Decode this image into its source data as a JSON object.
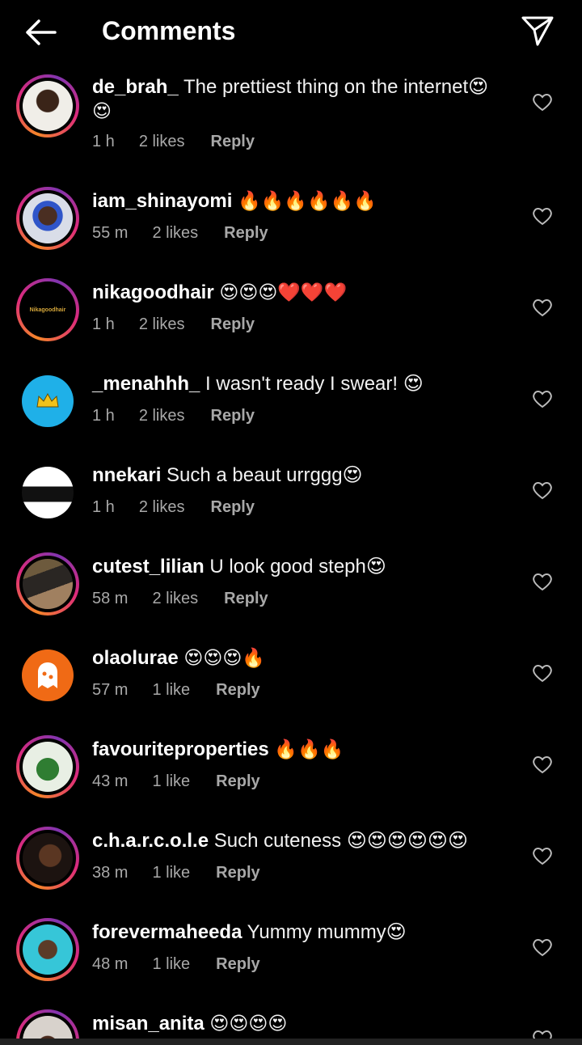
{
  "header": {
    "title": "Comments",
    "back_icon": "arrow-left-icon",
    "share_icon": "paper-plane-icon"
  },
  "colors": {
    "background": "#000000",
    "meta_text": "#a8a8a8",
    "ring_start": "#f58529",
    "ring_end": "#dd2a7b"
  },
  "comments": [
    {
      "username": "de_brah_",
      "text": "The prettiest thing on the internet😍",
      "text2": "😍",
      "time": "1 h",
      "likes": "2 likes",
      "reply": "Reply"
    },
    {
      "username": "iam_shinayomi",
      "text": "🔥🔥🔥🔥🔥🔥",
      "time": "55 m",
      "likes": "2 likes",
      "reply": "Reply"
    },
    {
      "username": "nikagoodhair",
      "text": "😍😍😍❤️❤️❤️",
      "time": "1 h",
      "likes": "2 likes",
      "reply": "Reply",
      "avatar_text": "Nikagoodhair"
    },
    {
      "username": "_menahhh_",
      "text": "I wasn't ready I swear! 😍",
      "time": "1 h",
      "likes": "2 likes",
      "reply": "Reply"
    },
    {
      "username": "nnekari",
      "text": "Such a beaut urrggg😍",
      "time": "1 h",
      "likes": "2 likes",
      "reply": "Reply"
    },
    {
      "username": "cutest_lilian",
      "text": "U look good steph😍",
      "time": "58 m",
      "likes": "2 likes",
      "reply": "Reply"
    },
    {
      "username": "olaolurae",
      "text": "😍😍😍🔥",
      "time": "57 m",
      "likes": "1 like",
      "reply": "Reply"
    },
    {
      "username": "favouriteproperties",
      "text": "🔥🔥🔥",
      "time": "43 m",
      "likes": "1 like",
      "reply": "Reply"
    },
    {
      "username": "c.h.a.r.c.o.l.e",
      "text": "Such cuteness 😍😍😍😍😍😍",
      "time": "38 m",
      "likes": "1 like",
      "reply": "Reply"
    },
    {
      "username": "forevermaheeda",
      "text": "Yummy mummy😍",
      "time": "48 m",
      "likes": "1 like",
      "reply": "Reply"
    },
    {
      "username": "misan_anita",
      "text": "😍😍😍😍",
      "time": "",
      "likes": "",
      "reply": ""
    }
  ]
}
